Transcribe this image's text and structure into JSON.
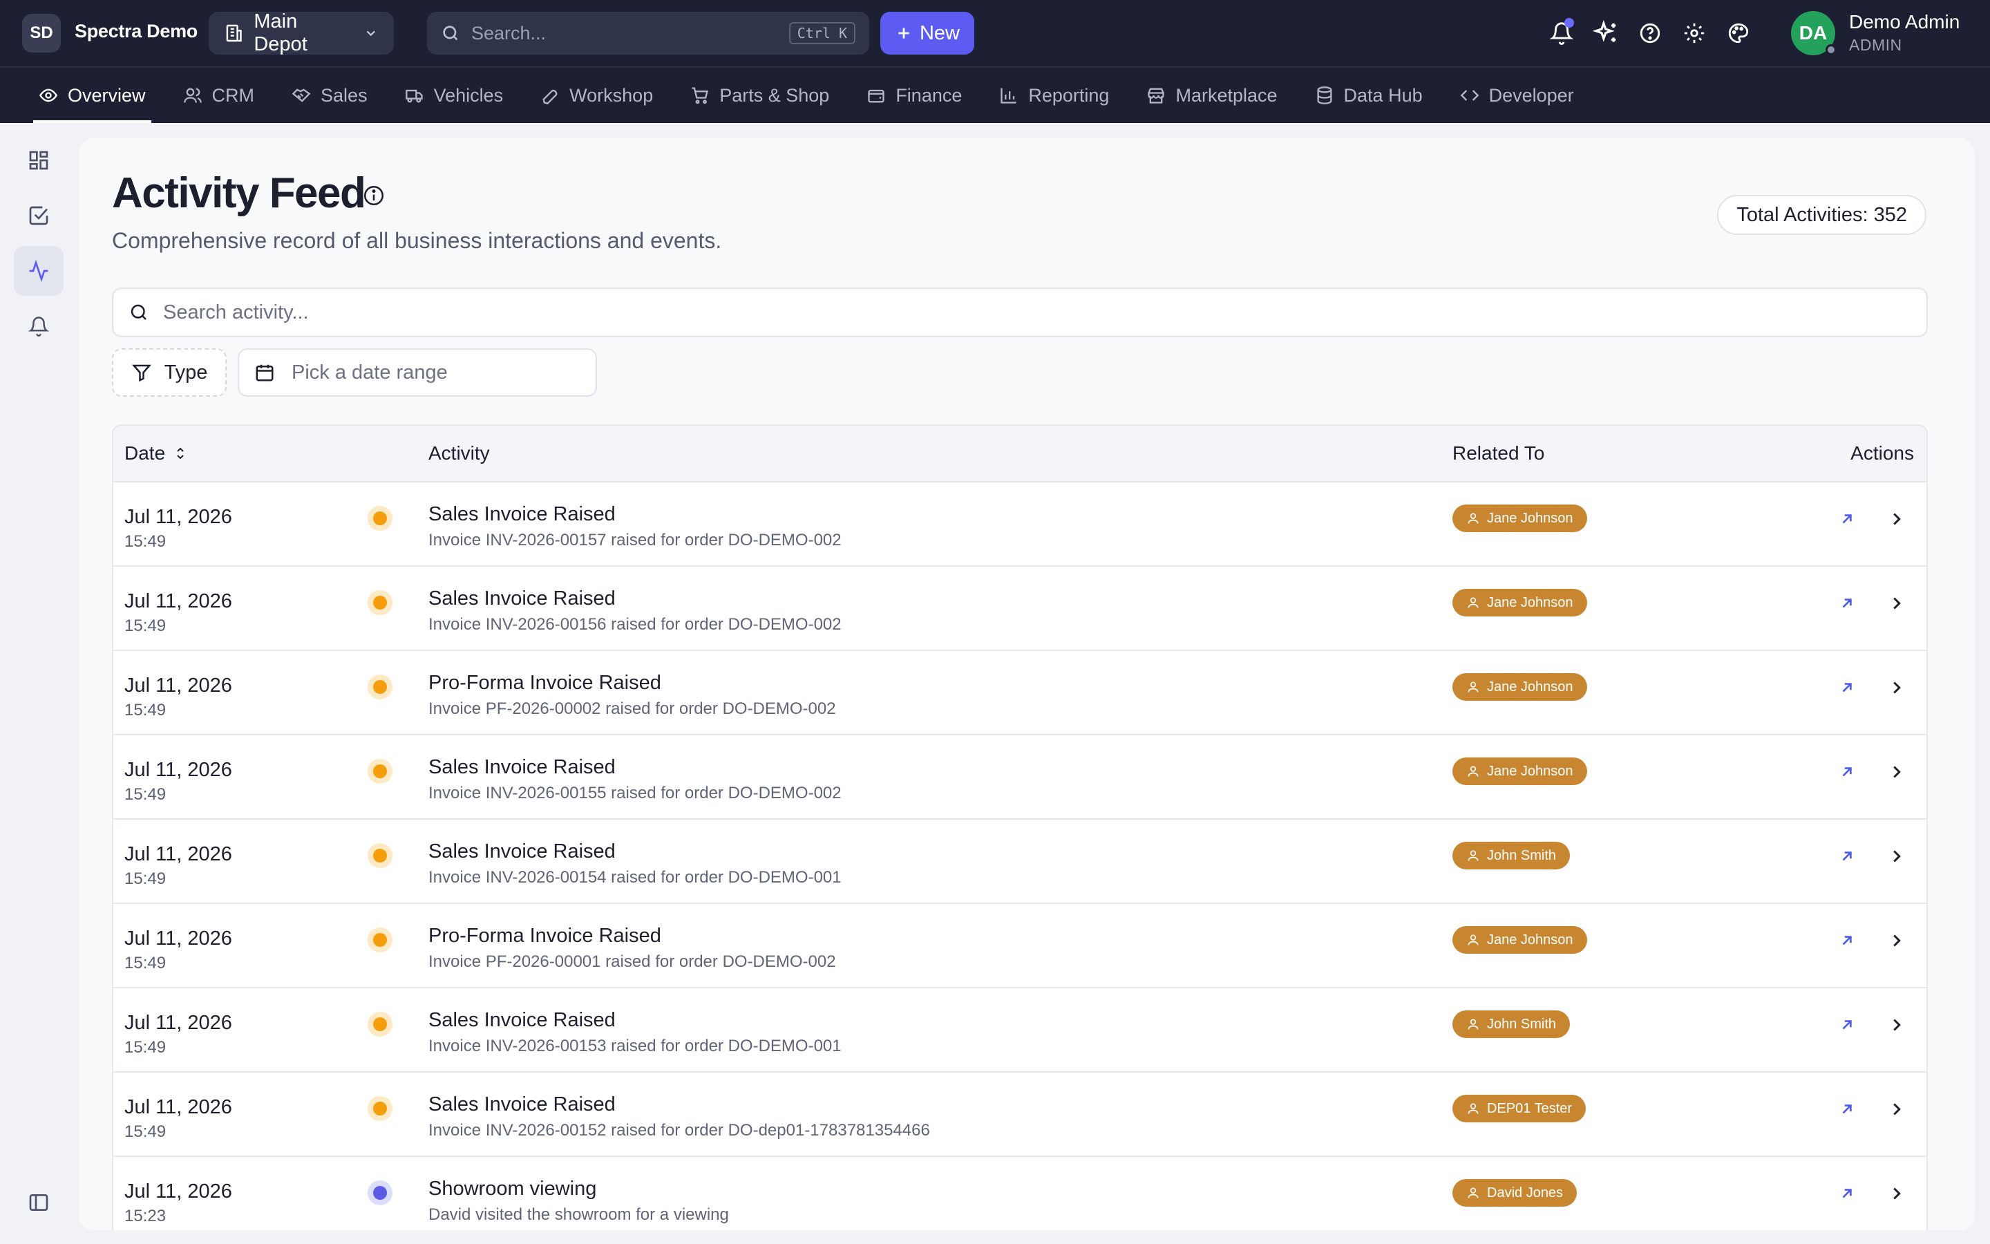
{
  "app": {
    "brand_initials": "SD",
    "brand_name": "Spectra Demo",
    "depot": "Main Depot",
    "search_placeholder": "Search...",
    "search_shortcut": "Ctrl K",
    "new_label": "New",
    "user_initials": "DA",
    "user_name": "Demo Admin",
    "user_role": "ADMIN"
  },
  "nav": [
    "Overview",
    "CRM",
    "Sales",
    "Vehicles",
    "Workshop",
    "Parts & Shop",
    "Finance",
    "Reporting",
    "Marketplace",
    "Data Hub",
    "Developer"
  ],
  "page": {
    "title": "Activity Feed",
    "subtitle": "Comprehensive record of all business interactions and events.",
    "total": "Total Activities: 352",
    "search_placeholder": "Search activity...",
    "type_filter": "Type",
    "date_placeholder": "Pick a date range"
  },
  "table": {
    "columns": [
      "Date",
      "Activity",
      "Related To",
      "Actions"
    ],
    "rows": [
      {
        "date": "Jul 11, 2026",
        "time": "15:49",
        "title": "Sales Invoice Raised",
        "desc": "Invoice INV-2026-00157 raised for order DO-DEMO-002",
        "related": "Jane Johnson",
        "kind": "invoice"
      },
      {
        "date": "Jul 11, 2026",
        "time": "15:49",
        "title": "Sales Invoice Raised",
        "desc": "Invoice INV-2026-00156 raised for order DO-DEMO-002",
        "related": "Jane Johnson",
        "kind": "invoice"
      },
      {
        "date": "Jul 11, 2026",
        "time": "15:49",
        "title": "Pro-Forma Invoice Raised",
        "desc": "Invoice PF-2026-00002 raised for order DO-DEMO-002",
        "related": "Jane Johnson",
        "kind": "invoice"
      },
      {
        "date": "Jul 11, 2026",
        "time": "15:49",
        "title": "Sales Invoice Raised",
        "desc": "Invoice INV-2026-00155 raised for order DO-DEMO-002",
        "related": "Jane Johnson",
        "kind": "invoice"
      },
      {
        "date": "Jul 11, 2026",
        "time": "15:49",
        "title": "Sales Invoice Raised",
        "desc": "Invoice INV-2026-00154 raised for order DO-DEMO-001",
        "related": "John Smith",
        "kind": "invoice"
      },
      {
        "date": "Jul 11, 2026",
        "time": "15:49",
        "title": "Pro-Forma Invoice Raised",
        "desc": "Invoice PF-2026-00001 raised for order DO-DEMO-002",
        "related": "Jane Johnson",
        "kind": "invoice"
      },
      {
        "date": "Jul 11, 2026",
        "time": "15:49",
        "title": "Sales Invoice Raised",
        "desc": "Invoice INV-2026-00153 raised for order DO-DEMO-001",
        "related": "John Smith",
        "kind": "invoice"
      },
      {
        "date": "Jul 11, 2026",
        "time": "15:49",
        "title": "Sales Invoice Raised",
        "desc": "Invoice INV-2026-00152 raised for order DO-dep01-1783781354466",
        "related": "DEP01 Tester",
        "kind": "invoice"
      },
      {
        "date": "Jul 11, 2026",
        "time": "15:23",
        "title": "Showroom viewing",
        "desc": "David visited the showroom for a viewing",
        "related": "David Jones",
        "kind": "viewing"
      }
    ]
  },
  "colors": {
    "topbar": "#1d2033",
    "accent": "#5c5cf3",
    "invoice_dot": "#f59e0b",
    "invoice_halo": "#fde9c4",
    "viewing_dot": "#5b5ce6",
    "viewing_halo": "#dcdcfb",
    "badge": "#c7862f"
  }
}
